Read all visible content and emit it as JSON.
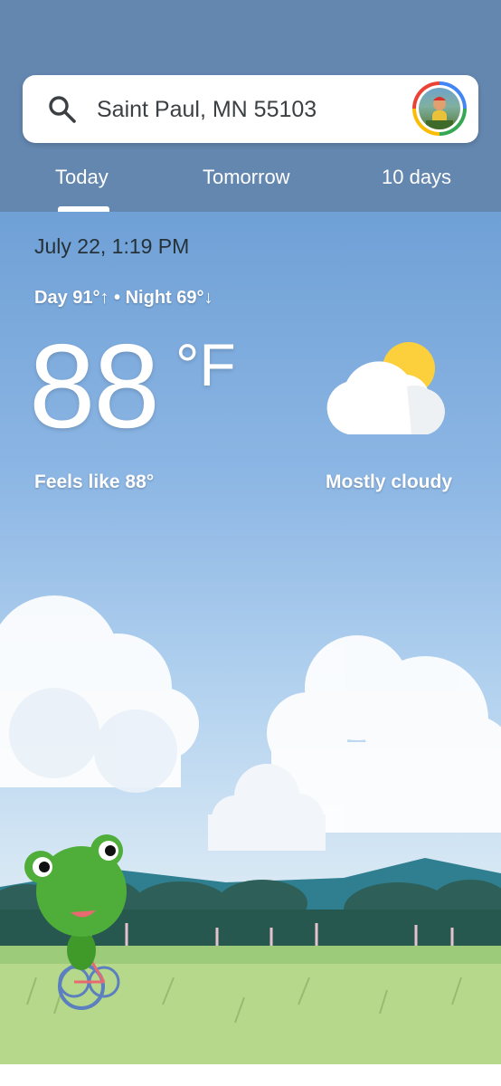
{
  "search": {
    "location": "Saint Paul, MN 55103",
    "search_icon": "search-icon",
    "avatar_icon": "account-avatar"
  },
  "tabs": [
    {
      "label": "Today",
      "selected": true
    },
    {
      "label": "Tomorrow",
      "selected": false
    },
    {
      "label": "10 days",
      "selected": false
    }
  ],
  "current": {
    "datetime": "July 22, 1:19 PM",
    "day_night": "Day 91°↑ • Night 69°↓",
    "temperature": "88",
    "unit": "°F",
    "feels_like": "Feels like 88°",
    "condition": "Mostly cloudy",
    "condition_icon": "mostly-cloudy-icon"
  },
  "colors": {
    "header_bg": "#6487b0",
    "sky_top": "#6fa0d6",
    "sun": "#fbd03c",
    "grass": "#b6d88a"
  }
}
